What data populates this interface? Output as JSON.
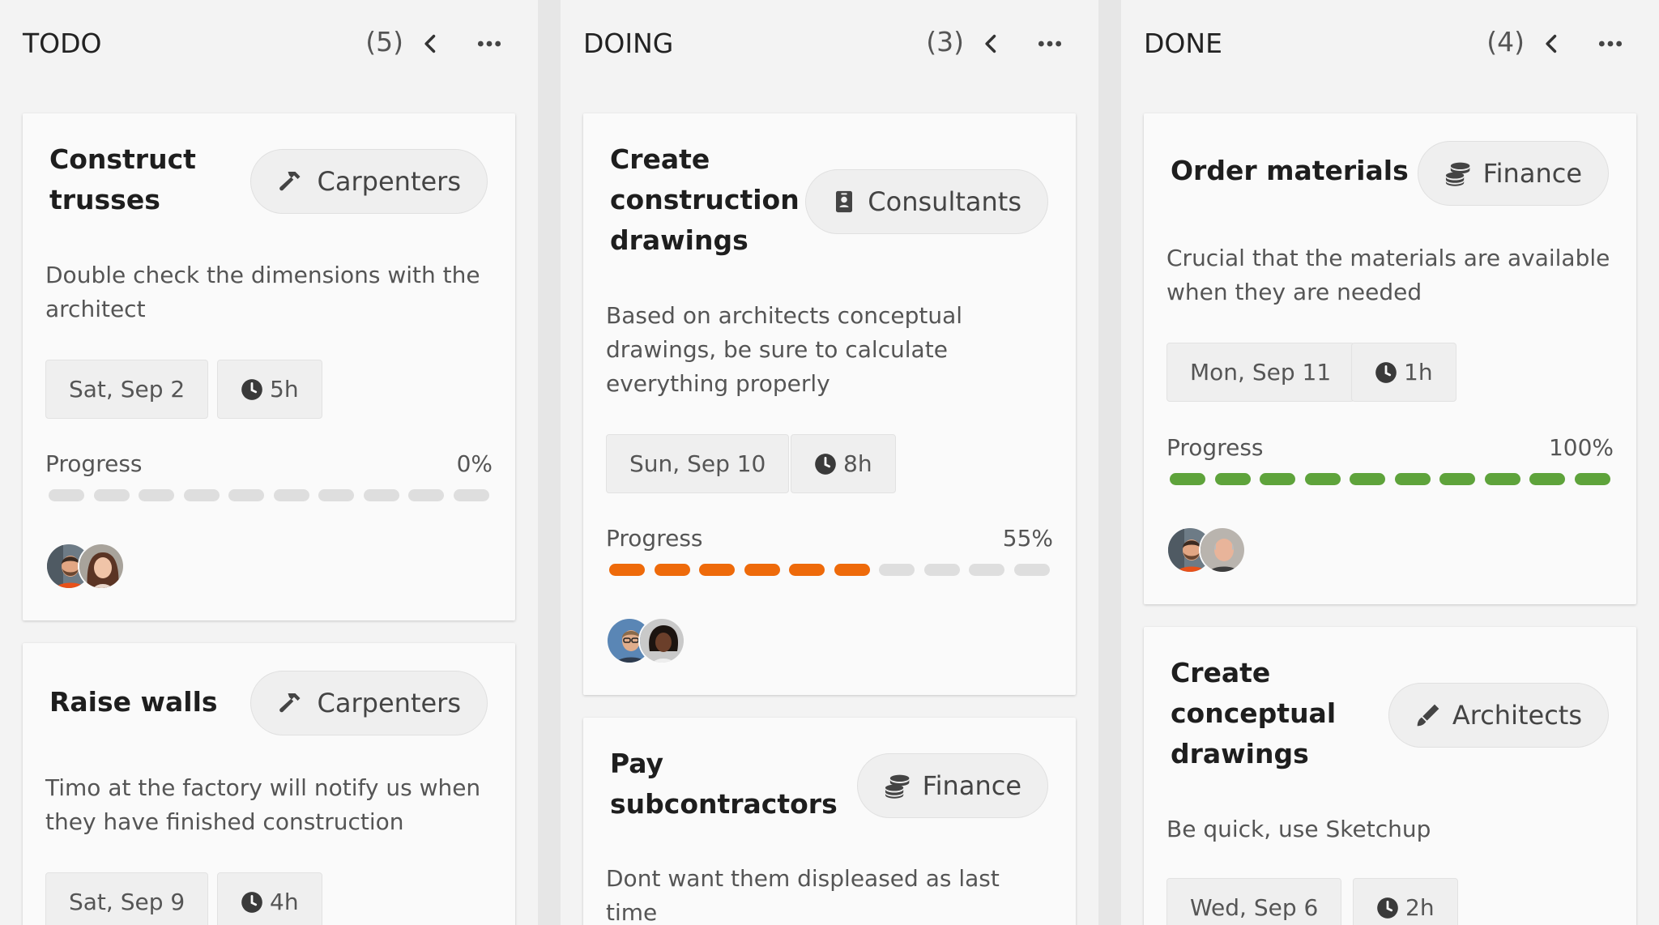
{
  "colors": {
    "todo_seg": "#dedede",
    "orange": "#ee6a0a",
    "green": "#5ea33b"
  },
  "columns": [
    {
      "title": "TODO",
      "count": "(5)",
      "cards": [
        {
          "title": "Construct trusses",
          "tag": {
            "label": "Carpenters",
            "icon": "hammer-icon"
          },
          "description": "Double check the dimensions with the architect",
          "date": "Sat, Sep 2",
          "duration": "5h",
          "progress_label": "Progress",
          "progress_text": "0%",
          "progress_percent": 0,
          "avatars": [
            "avatar-man-beard",
            "avatar-woman-brown-hair"
          ]
        },
        {
          "title": "Raise walls",
          "tag": {
            "label": "Carpenters",
            "icon": "hammer-icon"
          },
          "description": "Timo at the factory will notify us when they have finished construction",
          "date": "Sat, Sep 9",
          "duration": "4h"
        }
      ]
    },
    {
      "title": "DOING",
      "count": "(3)",
      "cards": [
        {
          "title": "Create construction drawings",
          "tag": {
            "label": "Consultants",
            "icon": "id-badge-icon"
          },
          "description": "Based on architects conceptual drawings, be sure to calculate everything properly",
          "date": "Sun, Sep 10",
          "duration": "8h",
          "progress_label": "Progress",
          "progress_text": "55%",
          "progress_percent": 55,
          "avatars": [
            "avatar-man-glasses",
            "avatar-woman-dark"
          ]
        },
        {
          "title": "Pay subcontractors",
          "tag": {
            "label": "Finance",
            "icon": "coins-icon"
          },
          "description": "Dont want them displeased as last time"
        }
      ]
    },
    {
      "title": "DONE",
      "count": "(4)",
      "cards": [
        {
          "title": "Order materials",
          "tag": {
            "label": "Finance",
            "icon": "coins-icon"
          },
          "description": "Crucial that the materials are available when they are needed",
          "date": "Mon, Sep 11",
          "duration": "1h",
          "progress_label": "Progress",
          "progress_text": "100%",
          "progress_percent": 100,
          "avatars": [
            "avatar-man-beard",
            "avatar-man-bald"
          ]
        },
        {
          "title": "Create conceptual drawings",
          "tag": {
            "label": "Architects",
            "icon": "pen-icon"
          },
          "description": "Be quick, use Sketchup",
          "date": "Wed, Sep 6",
          "duration": "2h"
        }
      ]
    }
  ]
}
